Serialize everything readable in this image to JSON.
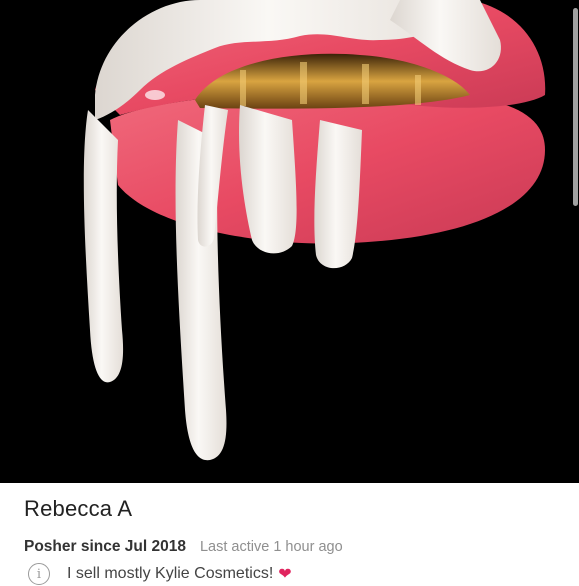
{
  "profile": {
    "cover_image": "dripping-lips-image",
    "name": "Rebecca A",
    "posher_since": "Posher since Jul 2018",
    "last_active": "Last active 1 hour ago",
    "bio": "I sell mostly Kylie Cosmetics!",
    "bio_emoji": "❤"
  },
  "colors": {
    "background": "#000000",
    "lip": "#e84a63",
    "drip": "#f3efea",
    "teeth": "#c8962f",
    "heart": "#e0245e"
  },
  "icons": {
    "info": "info-icon"
  }
}
